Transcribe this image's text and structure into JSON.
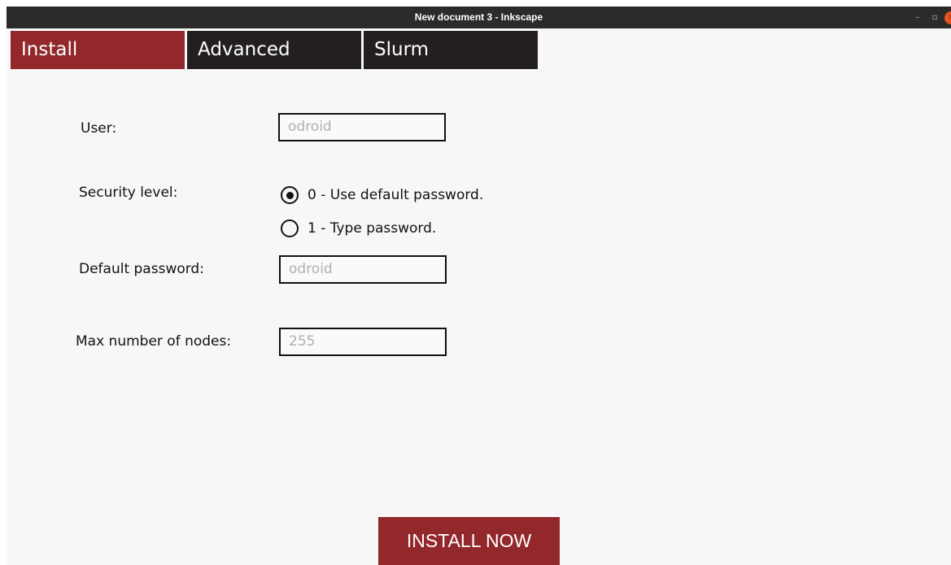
{
  "window": {
    "title": "New document 3 - Inkscape",
    "controls": {
      "minimize": "–",
      "maximize": "▫",
      "close": "×"
    }
  },
  "tabs": [
    {
      "label": "Install",
      "active": true
    },
    {
      "label": "Advanced",
      "active": false
    },
    {
      "label": "Slurm",
      "active": false
    }
  ],
  "form": {
    "user": {
      "label": "User:",
      "placeholder": "odroid"
    },
    "security": {
      "label": "Security level:",
      "options": [
        {
          "label": "0 - Use default password.",
          "selected": true
        },
        {
          "label": "1 - Type password.",
          "selected": false
        }
      ]
    },
    "default_password": {
      "label": "Default password:",
      "placeholder": "odroid"
    },
    "max_nodes": {
      "label": "Max number of nodes:",
      "placeholder": "255"
    }
  },
  "install_button": {
    "label": "INSTALL NOW"
  },
  "colors": {
    "accent": "#92282c",
    "tab_inactive": "#231f20",
    "titlebar": "#2b2b2b",
    "close_button": "#e95420"
  },
  "icons": {
    "minimize": "minimize-icon",
    "maximize": "maximize-icon",
    "close": "close-icon"
  }
}
